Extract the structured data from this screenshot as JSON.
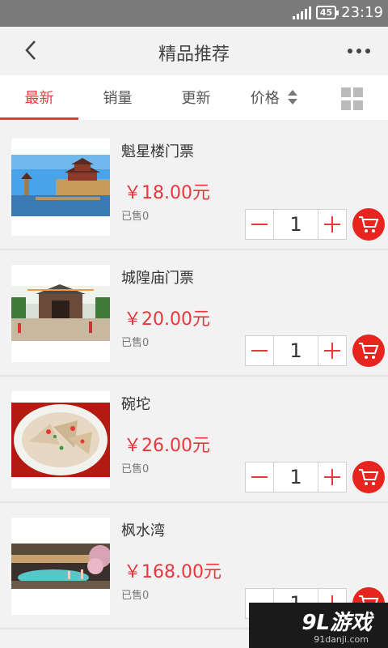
{
  "status_bar": {
    "battery": "45",
    "time": "23:19"
  },
  "nav": {
    "title": "精品推荐"
  },
  "tabs": [
    {
      "label": "最新",
      "active": true
    },
    {
      "label": "销量",
      "active": false
    },
    {
      "label": "更新",
      "active": false
    },
    {
      "label": "价格",
      "active": false
    }
  ],
  "items": [
    {
      "name": "魁星楼门票",
      "price": "￥18.00元",
      "sold": "已售0",
      "qty": "1"
    },
    {
      "name": "城隍庙门票",
      "price": "￥20.00元",
      "sold": "已售0",
      "qty": "1"
    },
    {
      "name": "碗坨",
      "price": "￥26.00元",
      "sold": "已售0",
      "qty": "1"
    },
    {
      "name": "枫水湾",
      "price": "￥168.00元",
      "sold": "已售0",
      "qty": "1"
    }
  ],
  "watermark": {
    "main": "9L游戏",
    "sub": "91danji.com"
  },
  "colors": {
    "accent": "#e8383d",
    "cart": "#e8241f",
    "status_bar": "#7a7a7a"
  }
}
